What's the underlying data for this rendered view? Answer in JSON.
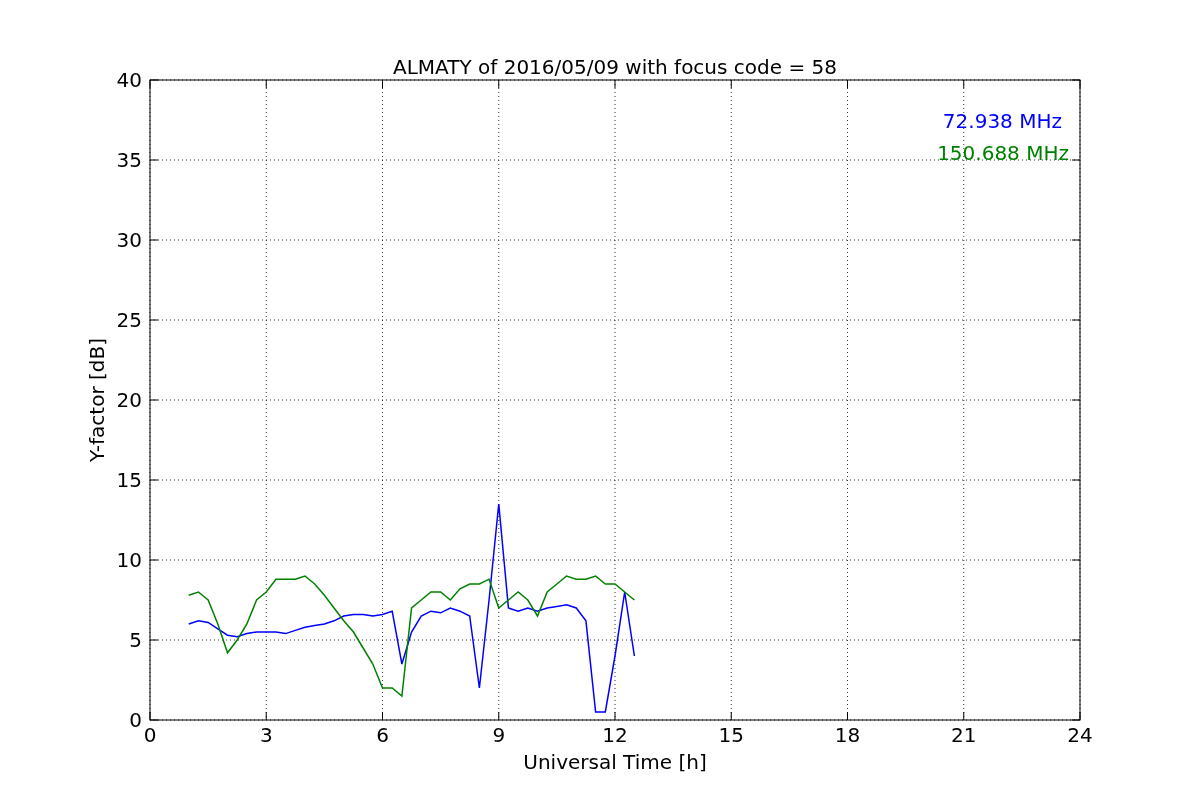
{
  "chart_data": {
    "type": "line",
    "title": "ALMATY of 2016/05/09 with focus code = 58",
    "xlabel": "Universal Time [h]",
    "ylabel": "Y-factor [dB]",
    "x": [
      1.0,
      1.25,
      1.5,
      1.75,
      2.0,
      2.25,
      2.5,
      2.75,
      3.0,
      3.25,
      3.5,
      3.75,
      4.0,
      4.25,
      4.5,
      4.75,
      5.0,
      5.25,
      5.5,
      5.75,
      6.0,
      6.25,
      6.5,
      6.75,
      7.0,
      7.25,
      7.5,
      7.75,
      8.0,
      8.25,
      8.5,
      8.75,
      9.0,
      9.25,
      9.5,
      9.75,
      10.0,
      10.25,
      10.5,
      10.75,
      11.0,
      11.25,
      11.5,
      11.75,
      12.0,
      12.25,
      12.5
    ],
    "series": [
      {
        "name": "72.938 MHz",
        "color": "#0000ff",
        "values": [
          6.0,
          6.2,
          6.1,
          5.7,
          5.3,
          5.2,
          5.4,
          5.5,
          5.5,
          5.5,
          5.4,
          5.6,
          5.8,
          5.9,
          6.0,
          6.2,
          6.5,
          6.6,
          6.6,
          6.5,
          6.6,
          6.8,
          3.5,
          5.5,
          6.5,
          6.8,
          6.7,
          7.0,
          6.8,
          6.5,
          2.0,
          7.5,
          13.5,
          7.0,
          6.8,
          7.0,
          6.8,
          7.0,
          7.1,
          7.2,
          7.0,
          6.2,
          0.5,
          0.5,
          4.0,
          8.0,
          4.0
        ]
      },
      {
        "name": "150.688 MHz",
        "color": "#008000",
        "values": [
          7.8,
          8.0,
          7.5,
          6.0,
          4.2,
          5.0,
          6.0,
          7.5,
          8.0,
          8.8,
          8.8,
          8.8,
          9.0,
          8.5,
          7.8,
          7.0,
          6.2,
          5.5,
          4.5,
          3.5,
          2.0,
          2.0,
          1.5,
          7.0,
          7.5,
          8.0,
          8.0,
          7.5,
          8.2,
          8.5,
          8.5,
          8.8,
          7.0,
          7.5,
          8.0,
          7.5,
          6.5,
          8.0,
          8.5,
          9.0,
          8.8,
          8.8,
          9.0,
          8.5,
          8.5,
          8.0,
          7.5
        ]
      }
    ],
    "grid": true,
    "xlim": [
      0,
      24
    ],
    "ylim": [
      0,
      40
    ],
    "xticks": [
      0,
      3,
      6,
      9,
      12,
      15,
      18,
      21,
      24
    ],
    "yticks": [
      0,
      5,
      10,
      15,
      20,
      25,
      30,
      35,
      40
    ]
  }
}
